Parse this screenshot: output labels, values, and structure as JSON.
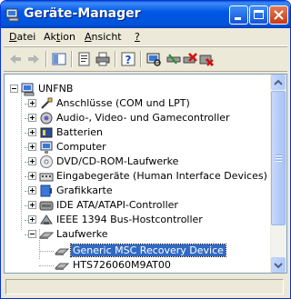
{
  "window": {
    "title": "Geräte-Manager"
  },
  "menu": [
    {
      "pre": "",
      "u": "D",
      "post": "atei"
    },
    {
      "pre": "Ak",
      "u": "t",
      "post": "ion"
    },
    {
      "pre": "",
      "u": "A",
      "post": "nsicht"
    },
    {
      "pre": "",
      "u": "?",
      "post": ""
    }
  ],
  "tree": {
    "root": "UNFNB",
    "categories": [
      {
        "label": "Anschlüsse (COM und LPT)",
        "icon": "port-icon"
      },
      {
        "label": "Audio-, Video- und Gamecontroller",
        "icon": "speaker-icon"
      },
      {
        "label": "Batterien",
        "icon": "battery-icon"
      },
      {
        "label": "Computer",
        "icon": "computer-icon"
      },
      {
        "label": "DVD/CD-ROM-Laufwerke",
        "icon": "cdrom-icon"
      },
      {
        "label": "Eingabegeräte (Human Interface Devices)",
        "icon": "hid-icon"
      },
      {
        "label": "Grafikkarte",
        "icon": "display-adapter-icon"
      },
      {
        "label": "IDE ATA/ATAPI-Controller",
        "icon": "ide-controller-icon"
      },
      {
        "label": "IEEE 1394 Bus-Hostcontroller",
        "icon": "firewire-icon"
      },
      {
        "label": "Laufwerke",
        "icon": "disk-drive-icon"
      }
    ],
    "drives": [
      {
        "label": "Generic MSC Recovery Device",
        "selected": true
      },
      {
        "label": "HTS726060M9AT00",
        "selected": false
      }
    ]
  },
  "status": {
    "text": ""
  }
}
